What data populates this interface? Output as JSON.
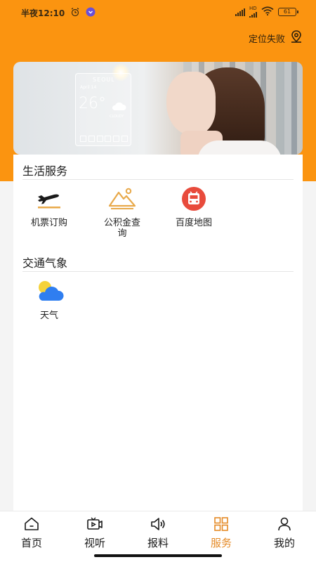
{
  "status_bar": {
    "time": "半夜12:10",
    "network_label": "HD",
    "battery": "61"
  },
  "location": {
    "label": "定位失败",
    "icon": "location-pin-icon"
  },
  "banner": {
    "weather_city": "SEOUL",
    "weather_date": "April 14",
    "weather_temp": "26°",
    "weather_condition": "CLOUDY"
  },
  "sections": [
    {
      "title": "生活服务",
      "items": [
        {
          "label": "机票订购",
          "icon": "airplane-icon"
        },
        {
          "label": "公积金查询",
          "icon": "mountain-icon"
        },
        {
          "label": "百度地图",
          "icon": "bus-icon"
        }
      ]
    },
    {
      "title": "交通气象",
      "items": [
        {
          "label": "天气",
          "icon": "weather-cloud-icon"
        }
      ]
    }
  ],
  "bottom_nav": {
    "items": [
      {
        "label": "首页",
        "icon": "home-icon"
      },
      {
        "label": "视听",
        "icon": "video-icon"
      },
      {
        "label": "报料",
        "icon": "speaker-icon"
      },
      {
        "label": "服务",
        "icon": "grid-icon",
        "active": true
      },
      {
        "label": "我的",
        "icon": "user-icon"
      }
    ]
  },
  "colors": {
    "brand_orange": "#fb9410",
    "active_tab": "#e58a26",
    "bus_red": "#e84b3c",
    "mountain_gold": "#e8a94a",
    "cloud_blue": "#2f7ef0"
  }
}
